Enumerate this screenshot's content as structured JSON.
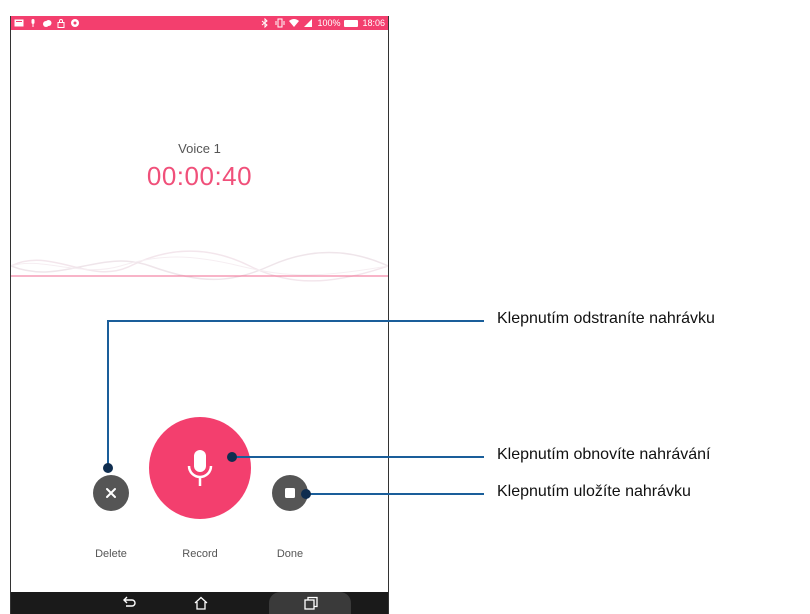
{
  "statusbar": {
    "battery_percent": "100%",
    "time": "18:06",
    "left_icons": [
      "message-icon",
      "microphone-icon",
      "cloud-icon",
      "lock-icon",
      "chat-icon"
    ],
    "right_icons": [
      "bluetooth-icon",
      "vibrate-icon",
      "wifi-icon",
      "signal-icon"
    ]
  },
  "recording": {
    "title": "Voice 1",
    "elapsed": "00:00:40"
  },
  "controls": {
    "delete_label": "Delete",
    "record_label": "Record",
    "done_label": "Done"
  },
  "navbar": {
    "icons": [
      "back-icon",
      "home-icon",
      "recent-apps-icon"
    ]
  },
  "callouts": {
    "delete": "Klepnutím odstraníte nahrávku",
    "record": "Klepnutím obnovíte nahrávání",
    "done": "Klepnutím uložíte nahrávku"
  },
  "colors": {
    "accent": "#f33f6e",
    "timer": "#f0507a",
    "callout_line": "#1a5e9a",
    "control_gray": "#555555"
  }
}
